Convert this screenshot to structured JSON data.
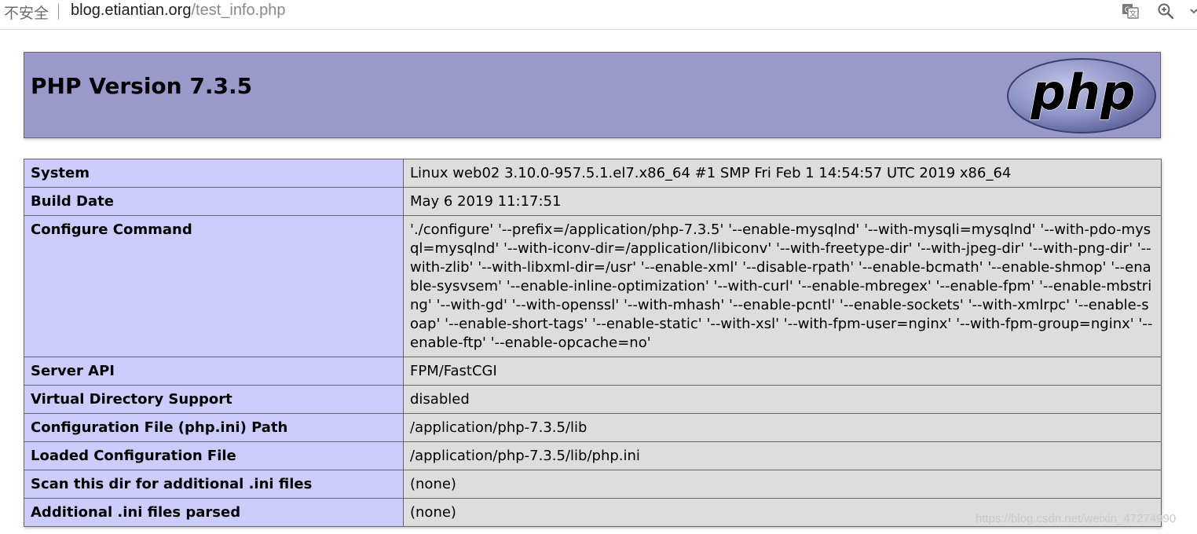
{
  "browser": {
    "security_label": "不安全",
    "url_host": "blog.etiantian.org",
    "url_path": "/test_info.php",
    "icons": [
      "translate-icon",
      "zoom-icon",
      "more-icon"
    ]
  },
  "page": {
    "title": "PHP Version 7.3.5",
    "logo_text": "php",
    "colors": {
      "header_bg": "#9999cc",
      "label_bg": "#ccccff",
      "value_bg": "#dddddd"
    }
  },
  "rows": [
    {
      "label": "System",
      "value": "Linux web02 3.10.0-957.5.1.el7.x86_64 #1 SMP Fri Feb 1 14:54:57 UTC 2019 x86_64"
    },
    {
      "label": "Build Date",
      "value": "May 6 2019 11:17:51"
    },
    {
      "label": "Configure Command",
      "value": "'./configure' '--prefix=/application/php-7.3.5' '--enable-mysqlnd' '--with-mysqli=mysqlnd' '--with-pdo-mysql=mysqlnd' '--with-iconv-dir=/application/libiconv' '--with-freetype-dir' '--with-jpeg-dir' '--with-png-dir' '--with-zlib' '--with-libxml-dir=/usr' '--enable-xml' '--disable-rpath' '--enable-bcmath' '--enable-shmop' '--enable-sysvsem' '--enable-inline-optimization' '--with-curl' '--enable-mbregex' '--enable-fpm' '--enable-mbstring' '--with-gd' '--with-openssl' '--with-mhash' '--enable-pcntl' '--enable-sockets' '--with-xmlrpc' '--enable-soap' '--enable-short-tags' '--enable-static' '--with-xsl' '--with-fpm-user=nginx' '--with-fpm-group=nginx' '--enable-ftp' '--enable-opcache=no'"
    },
    {
      "label": "Server API",
      "value": "FPM/FastCGI"
    },
    {
      "label": "Virtual Directory Support",
      "value": "disabled"
    },
    {
      "label": "Configuration File (php.ini) Path",
      "value": "/application/php-7.3.5/lib"
    },
    {
      "label": "Loaded Configuration File",
      "value": "/application/php-7.3.5/lib/php.ini"
    },
    {
      "label": "Scan this dir for additional .ini files",
      "value": "(none)"
    },
    {
      "label": "Additional .ini files parsed",
      "value": "(none)"
    }
  ],
  "watermark": "https://blog.csdn.net/weixin_47274990"
}
